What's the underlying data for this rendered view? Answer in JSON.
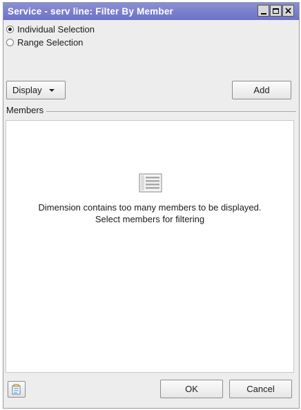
{
  "window": {
    "title": "Service - serv line: Filter By Member"
  },
  "selection_mode": {
    "options": [
      {
        "label": "Individual Selection",
        "checked": true
      },
      {
        "label": "Range Selection",
        "checked": false
      }
    ]
  },
  "toolbar": {
    "display_label": "Display",
    "add_label": "Add"
  },
  "members": {
    "group_label": "Members",
    "message_line1": "Dimension contains too many members to be displayed.",
    "message_line2": "Select members for filtering"
  },
  "footer": {
    "ok_label": "OK",
    "cancel_label": "Cancel"
  }
}
